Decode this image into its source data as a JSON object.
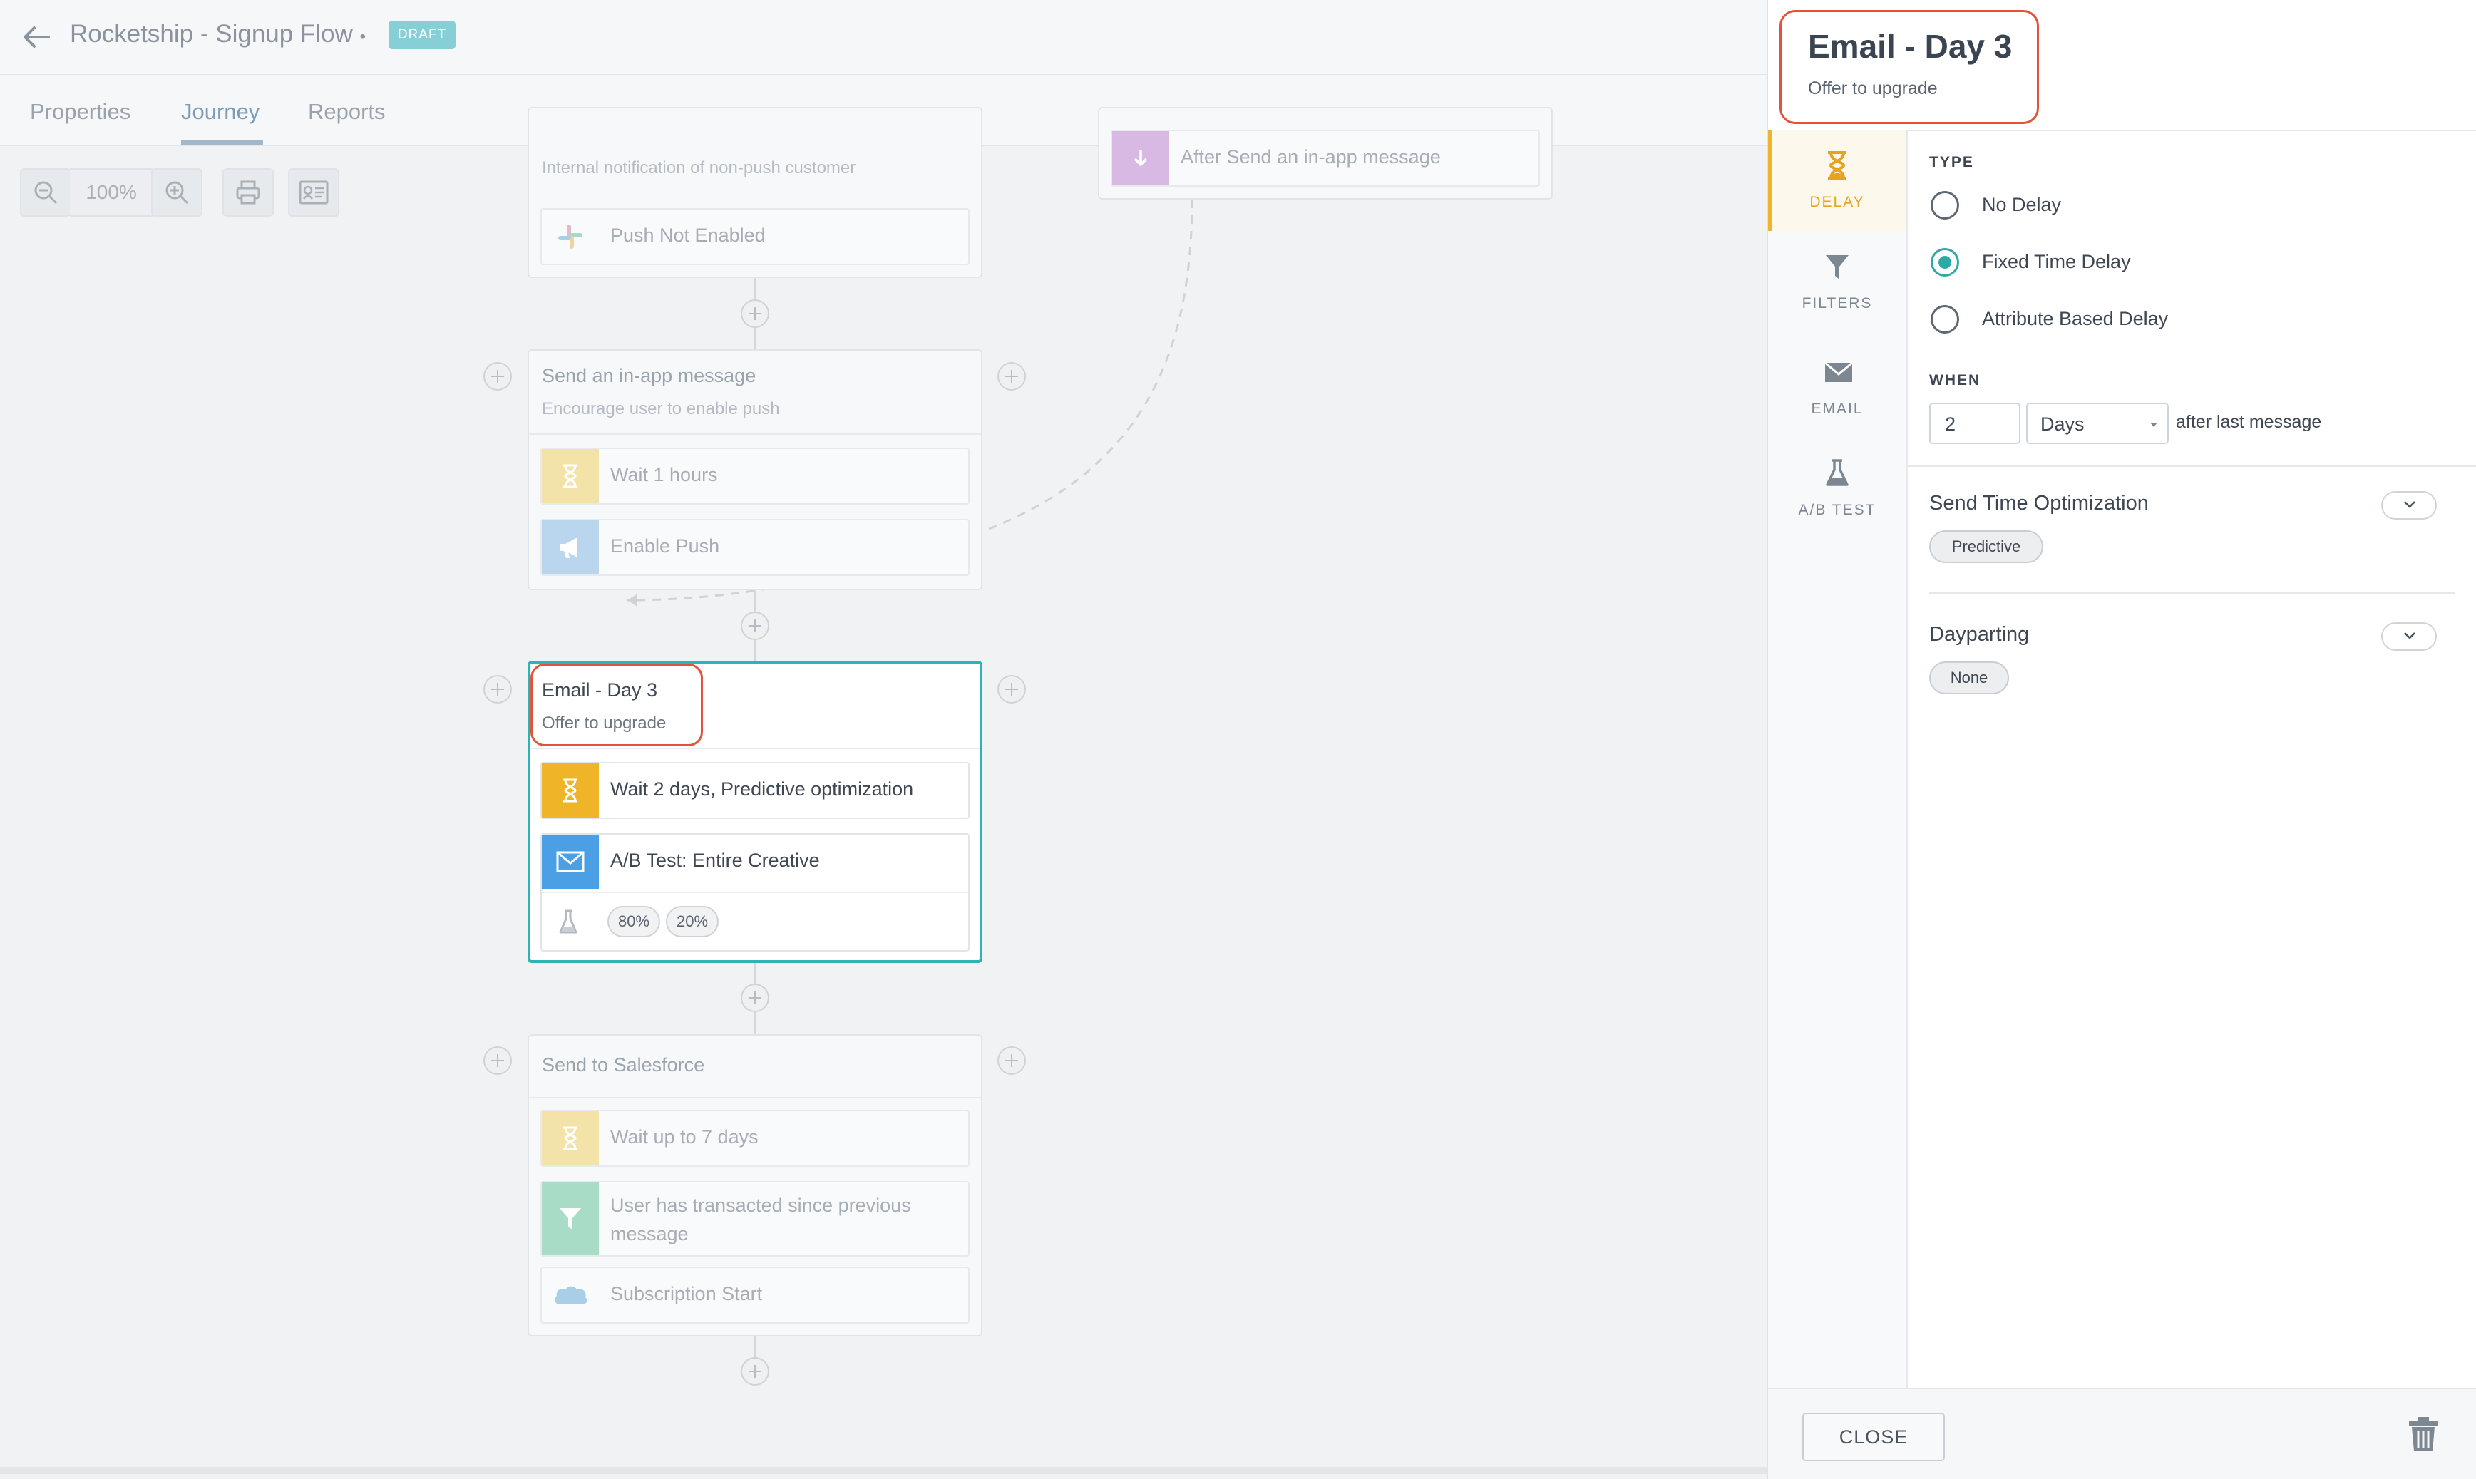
{
  "header": {
    "title": "Rocketship - Signup Flow",
    "title_suffix": "•",
    "badge": "DRAFT"
  },
  "tabs": [
    {
      "label": "Properties"
    },
    {
      "label": "Journey",
      "active": true
    },
    {
      "label": "Reports"
    }
  ],
  "toolbar": {
    "zoom": "100%"
  },
  "canvas": {
    "top_card": {
      "subtitle": "Internal notification of non-push customer",
      "row": "Push Not Enabled"
    },
    "branch_card": {
      "row": "After Send an in-app message"
    },
    "inapp_card": {
      "title": "Send an in-app message",
      "subtitle": "Encourage user to enable push",
      "rows": [
        "Wait 1 hours",
        "Enable Push"
      ]
    },
    "active_card": {
      "title": "Email - Day 3",
      "subtitle": "Offer to upgrade",
      "rows": [
        "Wait 2 days, Predictive optimization",
        "A/B Test: Entire Creative"
      ],
      "variants": [
        "80%",
        "20%"
      ]
    },
    "salesforce_card": {
      "title": "Send to Salesforce",
      "rows": [
        "Wait up to 7 days",
        "User has transacted since previous",
        "message",
        "Subscription Start"
      ]
    }
  },
  "panel": {
    "title": "Email - Day 3",
    "subtitle": "Offer to upgrade",
    "side_tabs": [
      {
        "label": "DELAY",
        "icon": "hourglass-icon",
        "active": true
      },
      {
        "label": "FILTERS",
        "icon": "filter-icon"
      },
      {
        "label": "EMAIL",
        "icon": "envelope-icon"
      },
      {
        "label": "A/B TEST",
        "icon": "flask-icon"
      }
    ],
    "type_label": "TYPE",
    "type_options": [
      {
        "label": "No Delay",
        "selected": false
      },
      {
        "label": "Fixed Time Delay",
        "selected": true
      },
      {
        "label": "Attribute Based Delay",
        "selected": false
      }
    ],
    "when_label": "WHEN",
    "when_value": "2",
    "when_unit": "Days",
    "when_suffix": "after last message",
    "send_time": {
      "title": "Send Time Optimization",
      "value": "Predictive"
    },
    "dayparting": {
      "title": "Dayparting",
      "value": "None"
    },
    "close_label": "CLOSE"
  },
  "colors": {
    "accent_teal": "#2cb3b6",
    "delay_yellow": "#f0b429",
    "email_blue": "#4a9fe5",
    "highlight_red": "#e2543a"
  }
}
